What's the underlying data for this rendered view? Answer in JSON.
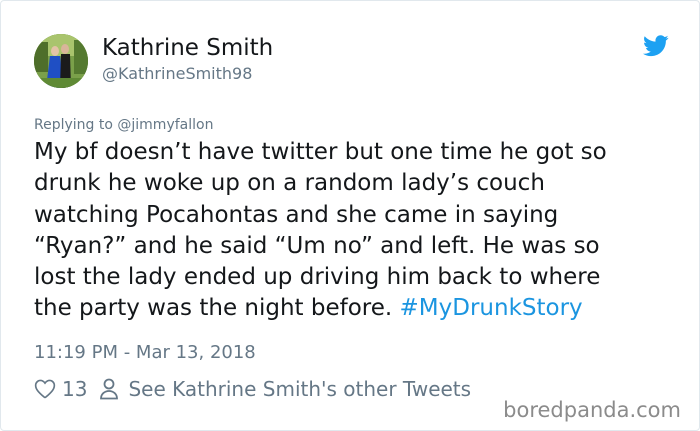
{
  "author": {
    "display_name": "Kathrine Smith",
    "handle": "@KathrineSmith98",
    "avatar_icon": "profile-photo"
  },
  "reply": {
    "prefix": "Replying to ",
    "mention": "@jimmyfallon"
  },
  "tweet": {
    "lines": [
      "My bf doesn’t have twitter but one time he got so",
      "drunk he woke up on a random lady’s couch",
      "watching Pocahontas and she came in saying",
      "“Ryan?” and he said “Um no” and left. He was so",
      "lost the lady ended up driving him back to where",
      "the party was the night before. "
    ],
    "hashtag": "#MyDrunkStory",
    "timestamp": "11:19 PM - Mar 13, 2018"
  },
  "actions": {
    "like_count": "13",
    "other_tweets_label": "See Kathrine Smith's other Tweets"
  },
  "watermark": "boredpanda.com",
  "colors": {
    "link": "#1b95e0",
    "muted": "#657786",
    "text": "#14171a",
    "twitter_blue": "#1da1f2"
  },
  "icons": [
    "twitter-bird-icon",
    "heart-icon",
    "person-icon"
  ]
}
